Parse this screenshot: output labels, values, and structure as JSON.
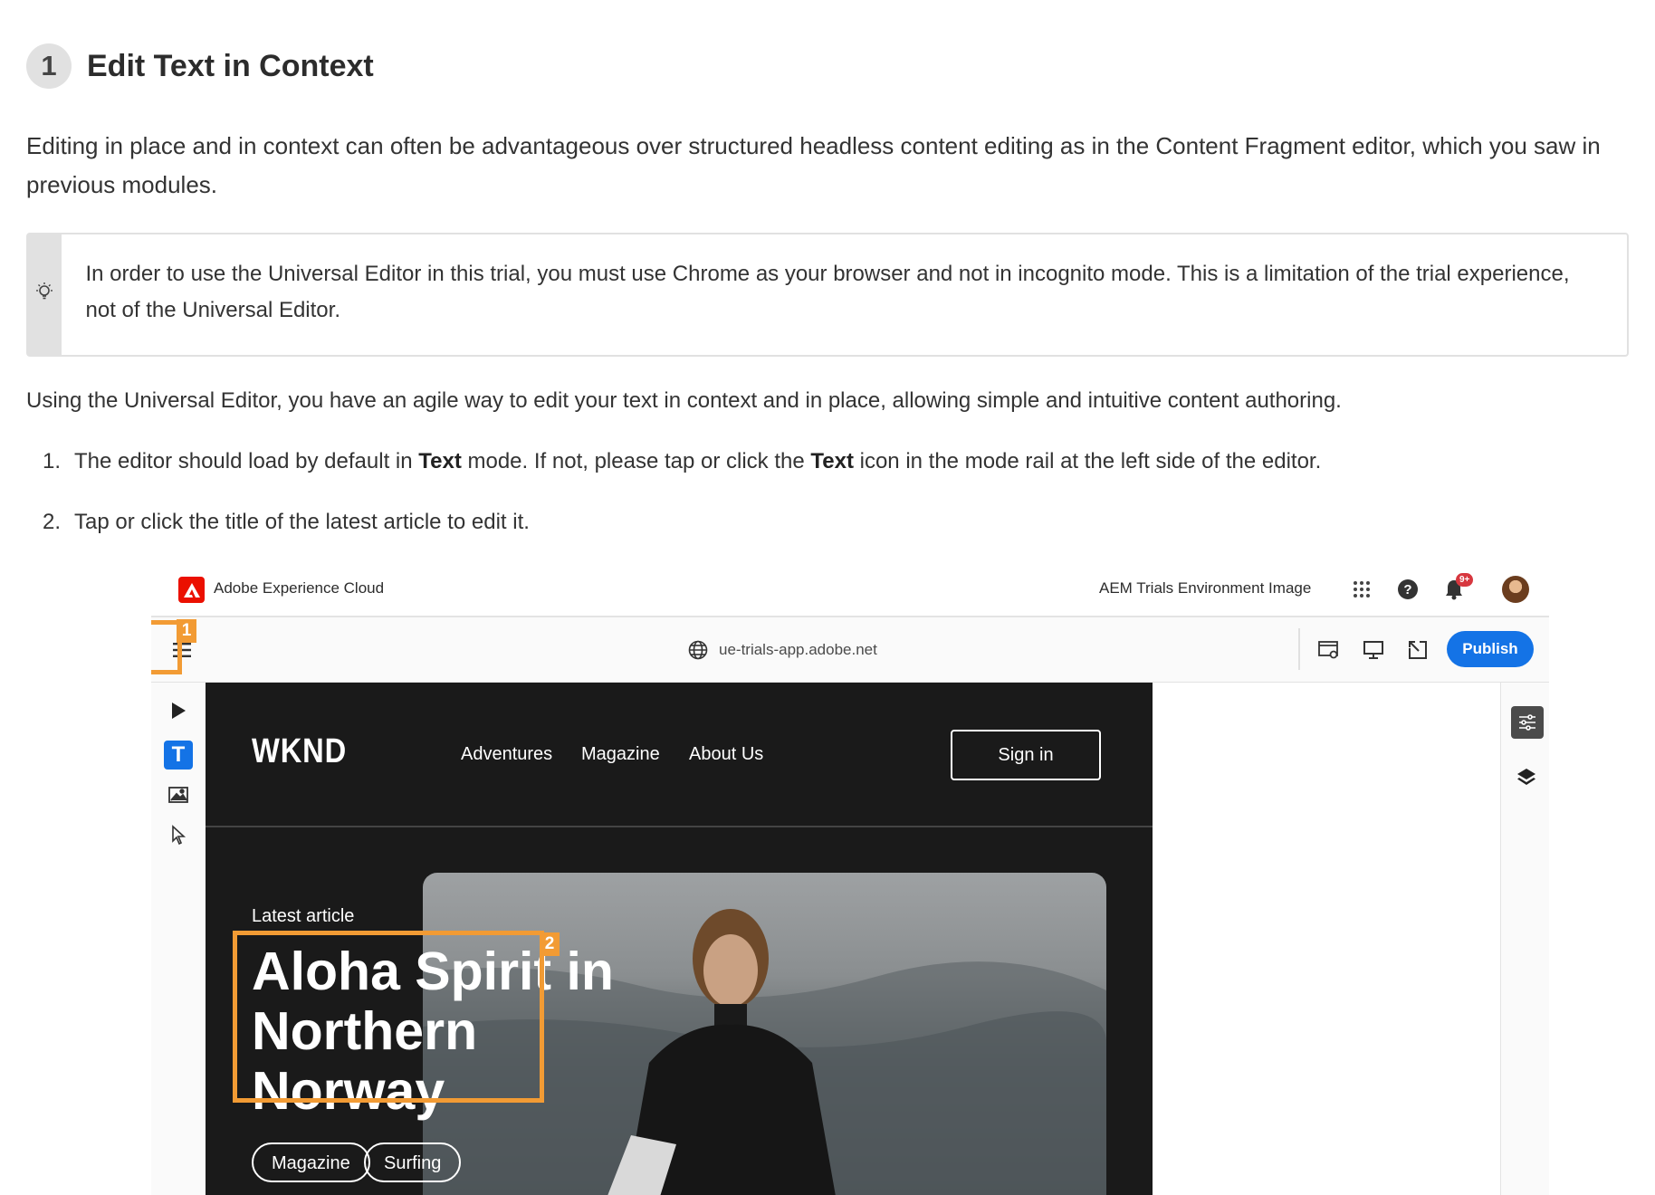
{
  "heading": {
    "step": "1",
    "title": "Edit Text in Context"
  },
  "intro": "Editing in place and in context can often be advantageous over structured headless content editing as in the Content Fragment editor, which you saw in previous modules.",
  "note": {
    "icon": "lightbulb-icon",
    "text": "In order to use the Universal Editor in this trial, you must use Chrome as your browser and not in incognito mode. This is a limitation of the trial experience, not of the Universal Editor."
  },
  "using": "Using the Universal Editor, you have an agile way to edit your text in context and in place, allowing simple and intuitive content authoring.",
  "steps": [
    {
      "num": "1.",
      "p1": "The editor should load by default in ",
      "b1": "Text",
      "p2": " mode. If not, please tap or click the ",
      "b2": "Text",
      "p3": " icon in the mode rail at the left side of the editor."
    },
    {
      "num": "2.",
      "text": "Tap or click the title of the latest article to edit it."
    }
  ],
  "screenshot": {
    "shell": {
      "brand": "Adobe Experience Cloud",
      "environment": "AEM Trials Environment Image",
      "notification_badge": "9+"
    },
    "toolbar": {
      "url": "ue-trials-app.adobe.net",
      "publish_label": "Publish"
    },
    "rail": {
      "text_mode_label": "T"
    },
    "site": {
      "logo": "WKND",
      "nav": [
        "Adventures",
        "Magazine",
        "About Us"
      ],
      "signin": "Sign in",
      "latest_label": "Latest article",
      "article_title": "Aloha Spirit in Northern Norway",
      "tags": [
        "Magazine",
        "Surfing"
      ]
    },
    "callouts": [
      "1",
      "2"
    ],
    "accent_color": "#f29b34",
    "publish_color": "#1473e6"
  }
}
